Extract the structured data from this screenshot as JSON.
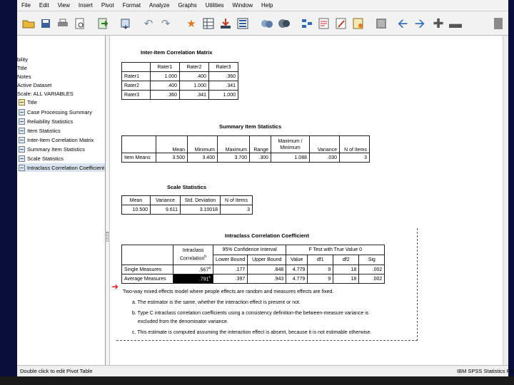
{
  "menu": [
    "File",
    "Edit",
    "View",
    "Insert",
    "Pivot",
    "Format",
    "Analyze",
    "Graphs",
    "Utilities",
    "Window",
    "Help"
  ],
  "toolbar_icons": [
    "open-folder-icon",
    "save-icon",
    "print-icon",
    "print-preview-icon",
    "export-icon",
    "recall-dialog-icon",
    "undo-icon",
    "redo-icon",
    "goto-data-icon",
    "goto-case-icon",
    "goto-variable-icon",
    "variables-icon",
    "designate-window-icon",
    "show-all-icon",
    "select-icon",
    "script-icon",
    "chart-builder-icon",
    "insert-heading-icon",
    "insert-title-icon",
    "insert-text-icon",
    "hide-icon",
    "promote-icon",
    "demote-icon",
    "expand-icon",
    "collapse-icon"
  ],
  "nav": {
    "items": [
      {
        "label": "bility",
        "indent": 0
      },
      {
        "label": "Title",
        "indent": 0
      },
      {
        "label": "Notes",
        "indent": 0
      },
      {
        "label": "Active Dataset",
        "indent": 0
      },
      {
        "label": "Scale: ALL VARIABLES",
        "indent": 0
      },
      {
        "label": "Title",
        "indent": 1
      },
      {
        "label": "Case Processing Summary",
        "indent": 1
      },
      {
        "label": "Reliability Statistics",
        "indent": 1
      },
      {
        "label": "Item Statistics",
        "indent": 1
      },
      {
        "label": "Inter-Item Correlation Matrix",
        "indent": 1
      },
      {
        "label": "Summary Item Statistics",
        "indent": 1
      },
      {
        "label": "Scale Statistics",
        "indent": 1
      },
      {
        "label": "Intraclass Correlation Coefficient",
        "indent": 1
      }
    ]
  },
  "inter_item": {
    "title": "Inter-Item Correlation Matrix",
    "headers": [
      "",
      "Rater1",
      "Rater2",
      "Rater3"
    ],
    "rows": [
      [
        "Rater1",
        "1.000",
        ".400",
        ".360"
      ],
      [
        "Rater2",
        ".400",
        "1.000",
        ".341"
      ],
      [
        "Rater3",
        ".360",
        ".341",
        "1.000"
      ]
    ]
  },
  "summary_item": {
    "title": "Summary Item Statistics",
    "headers": [
      "",
      "Mean",
      "Minimum",
      "Maximum",
      "Range",
      "Maximum / Minimum",
      "Variance",
      "N of Items"
    ],
    "row": [
      "Item Means",
      "3.500",
      "3.400",
      "3.700",
      ".300",
      "1.088",
      ".030",
      "3"
    ]
  },
  "scale_stats": {
    "title": "Scale Statistics",
    "headers": [
      "Mean",
      "Variance",
      "Std. Deviation",
      "N of Items"
    ],
    "row": [
      "10.500",
      "9.611",
      "3.10018",
      "3"
    ]
  },
  "icc": {
    "title": "Intraclass Correlation Coefficient",
    "col_icc": "Intraclass Correlation",
    "col_icc_sup": "b",
    "ci_header": "95% Confidence Interval",
    "f_header": "F Test with True Value 0",
    "sub_headers": [
      "Lower Bound",
      "Upper Bound",
      "Value",
      "df1",
      "df2",
      "Sig"
    ],
    "rows": [
      {
        "label": "Single Measures",
        "icc": ".567",
        "sup": "a",
        "values": [
          ".177",
          ".848",
          "4.779",
          "9",
          "18",
          ".002"
        ]
      },
      {
        "label": "Average Measures",
        "icc": ".791",
        "sup": "c",
        "values": [
          ".397",
          ".943",
          "4.779",
          "9",
          "18",
          ".002"
        ]
      }
    ],
    "footnotes": [
      "Two-way mixed effects model where people effects are random and measures effects are fixed.",
      "a. The estimator is the same, whether the interaction effect is present or not.",
      "b. Type C intraclass correlation coefficients using a consistency definition-the between-measure variance is",
      "excluded from the denominator variance.",
      "c. This estimate is computed assuming the interaction effect is absent, because it is not estimable otherwise."
    ]
  },
  "status": {
    "left": "Double click to edit Pivot Table",
    "right": "IBM SPSS Statistics Proc"
  },
  "colors": {
    "frame": "#0a0f3a",
    "highlight": "#000000",
    "arrow": "#e02020"
  }
}
